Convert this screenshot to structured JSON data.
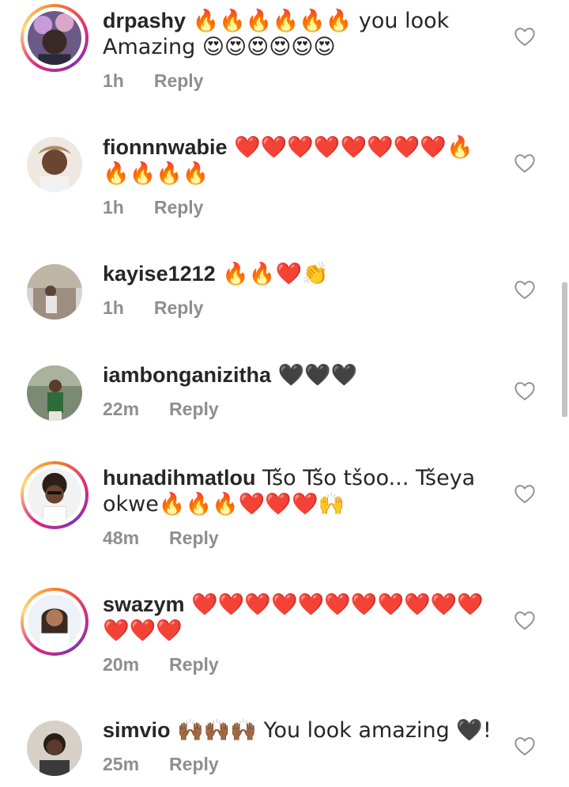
{
  "comments": [
    {
      "user": "drpashy",
      "text": " 🔥🔥🔥🔥🔥🔥 you look Amazing 😍😍😍😍😍😍",
      "time": "1h",
      "reply": "Reply",
      "story_ring": true
    },
    {
      "user": "fionnnwabie",
      "text": " ❤️❤️❤️❤️❤️❤️❤️❤️🔥🔥🔥🔥🔥",
      "time": "1h",
      "reply": "Reply",
      "story_ring": false
    },
    {
      "user": "kayise1212",
      "text": " 🔥🔥❤️👏",
      "time": "1h",
      "reply": "Reply",
      "story_ring": false
    },
    {
      "user": "iambonganizitha",
      "text": " 🖤🖤🖤",
      "time": "22m",
      "reply": "Reply",
      "story_ring": false
    },
    {
      "user": "hunadihmatlou",
      "text": " Tšo Tšo tšoo... Tšeya okwe🔥🔥🔥❤️❤️❤️🙌",
      "time": "48m",
      "reply": "Reply",
      "story_ring": true
    },
    {
      "user": "swazym",
      "text": " ❤️❤️❤️❤️❤️❤️❤️❤️❤️❤️❤️❤️❤️❤️",
      "time": "20m",
      "reply": "Reply",
      "story_ring": true
    },
    {
      "user": "simvio",
      "text": " 🙌🏾🙌🏾🙌🏾 You look amazing 🖤!",
      "time": "25m",
      "reply": "Reply",
      "story_ring": false
    }
  ],
  "icons": {
    "like": "heart-outline-icon"
  },
  "colors": {
    "text": "#262626",
    "meta": "#8e8e8e",
    "ring_start": "#f58529",
    "ring_mid": "#dd2a7b"
  }
}
